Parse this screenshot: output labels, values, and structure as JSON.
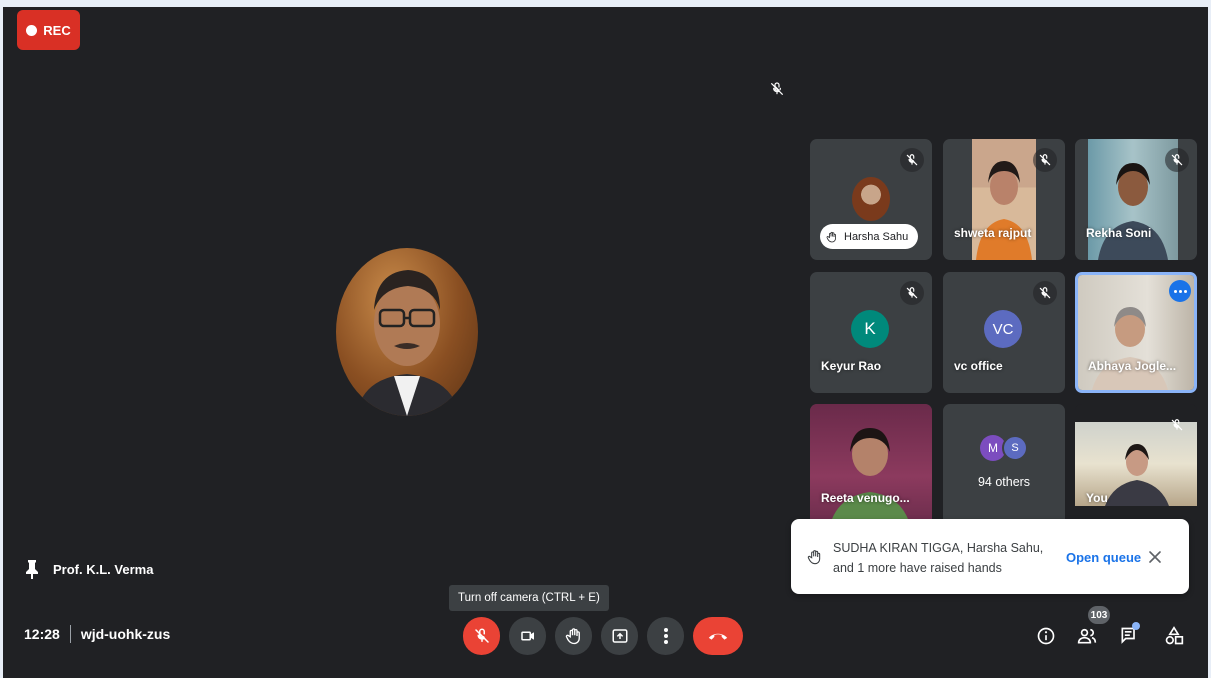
{
  "recording": {
    "label": "REC"
  },
  "presenter": {
    "name": "Prof. K.L. Verma"
  },
  "meeting": {
    "time": "12:28",
    "code": "wjd-uohk-zus"
  },
  "tiles": {
    "harsha": {
      "name": "Harsha Sahu"
    },
    "shweta": {
      "name": "shweta rajput"
    },
    "rekha": {
      "name": "Rekha Soni"
    },
    "keyur": {
      "name": "Keyur Rao",
      "initial": "K"
    },
    "vc": {
      "name": "vc office",
      "initial": "VC"
    },
    "abhaya": {
      "name": "Abhaya Jogle..."
    },
    "reeta": {
      "name": "Reeta venugo..."
    },
    "others": {
      "label": "94 others",
      "avatar1": "M",
      "avatar2": "S"
    },
    "you": {
      "name": "You"
    }
  },
  "toast": {
    "message": "SUDHA KIRAN TIGGA, Harsha Sahu, and 1 more have raised hands",
    "action": "Open queue"
  },
  "tooltip": {
    "text": "Turn off camera (CTRL + E)"
  },
  "participants": {
    "count": "103"
  },
  "colors": {
    "end_call": "#ea4335",
    "mic_off": "#ea4335",
    "keyur": "#00897b",
    "vc": "#5c6bc0",
    "accent": "#1a73e8"
  }
}
